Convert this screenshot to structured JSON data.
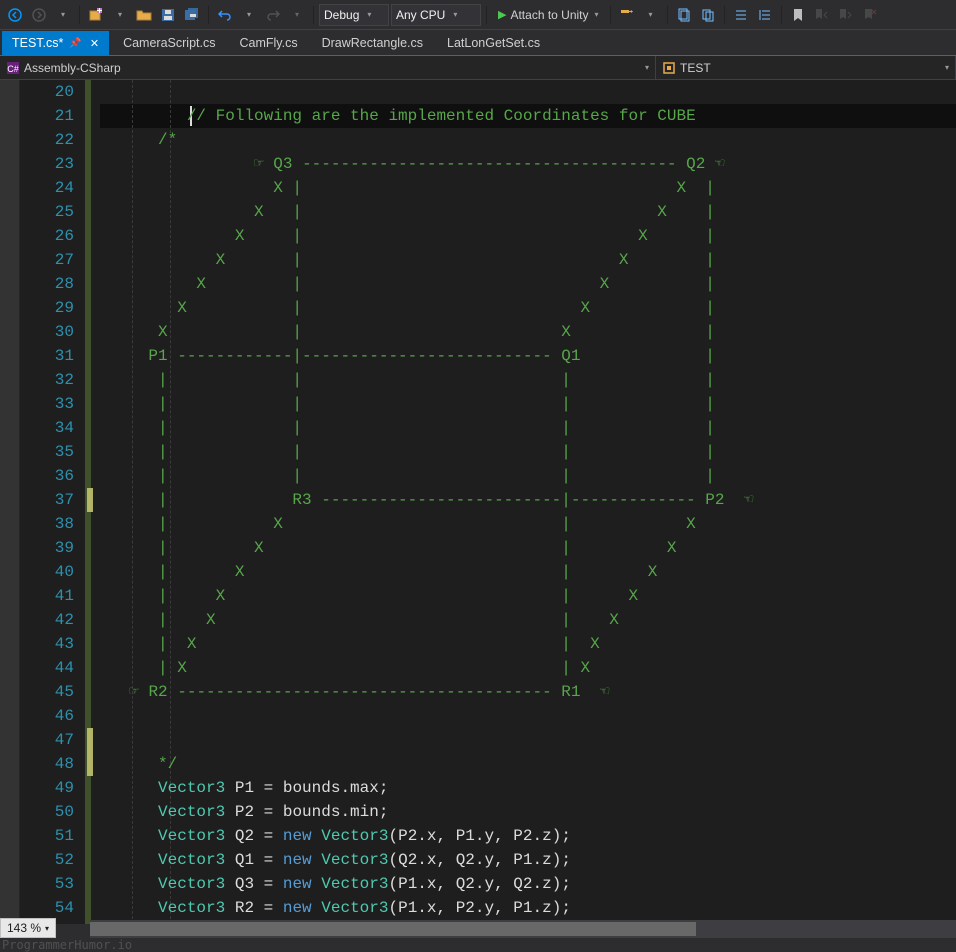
{
  "toolbar": {
    "config": "Debug",
    "platform": "Any CPU",
    "attach": "Attach to Unity"
  },
  "tabs": [
    {
      "label": "TEST.cs*",
      "active": true,
      "pinned": true
    },
    {
      "label": "CameraScript.cs",
      "active": false
    },
    {
      "label": "CamFly.cs",
      "active": false
    },
    {
      "label": "DrawRectangle.cs",
      "active": false
    },
    {
      "label": "LatLonGetSet.cs",
      "active": false
    }
  ],
  "nav": {
    "project": "Assembly-CSharp",
    "member": "TEST"
  },
  "editor": {
    "first_line": 20,
    "last_line": 54,
    "highlight_line": 21,
    "change_marks": [
      37,
      47,
      48
    ],
    "lines": [
      "",
      "        // Following are the implemented Coordinates for CUBE",
      "     /*",
      "               ☞ Q3 --------------------------------------- Q2 ☜",
      "                 X |                                       X  |",
      "               X   |                                     X    |",
      "             X     |                                   X      |",
      "           X       |                                 X        |",
      "         X         |                               X          |",
      "       X           |                             X            |",
      "     X             |                           X              |",
      "    P1 ------------|-------------------------- Q1             |",
      "     |             |                           |              |",
      "     |             |                           |              |",
      "     |             |                           |              |",
      "     |             |                           |              |",
      "     |             |                           |              |",
      "     |             R3 -------------------------|------------- P2  ☜",
      "     |           X                             |            X",
      "     |         X                               |          X",
      "     |       X                                 |        X",
      "     |     X                                   |      X",
      "     |    X                                    |    X",
      "     |  X                                      |  X",
      "     | X                                       | X",
      "  ☞ R2 --------------------------------------- R1  ☜",
      "",
      "",
      "     */",
      "     Vector3 P1 = bounds.max;",
      "     Vector3 P2 = bounds.min;",
      "     Vector3 Q2 = new Vector3(P2.x, P1.y, P2.z);",
      "     Vector3 Q1 = new Vector3(Q2.x, Q2.y, P1.z);",
      "     Vector3 Q3 = new Vector3(P1.x, Q2.y, Q2.z);",
      "     Vector3 R2 = new Vector3(P1.x, P2.y, P1.z);"
    ]
  },
  "status": {
    "zoom": "143 %"
  },
  "watermark": "ProgrammerHumor.io"
}
